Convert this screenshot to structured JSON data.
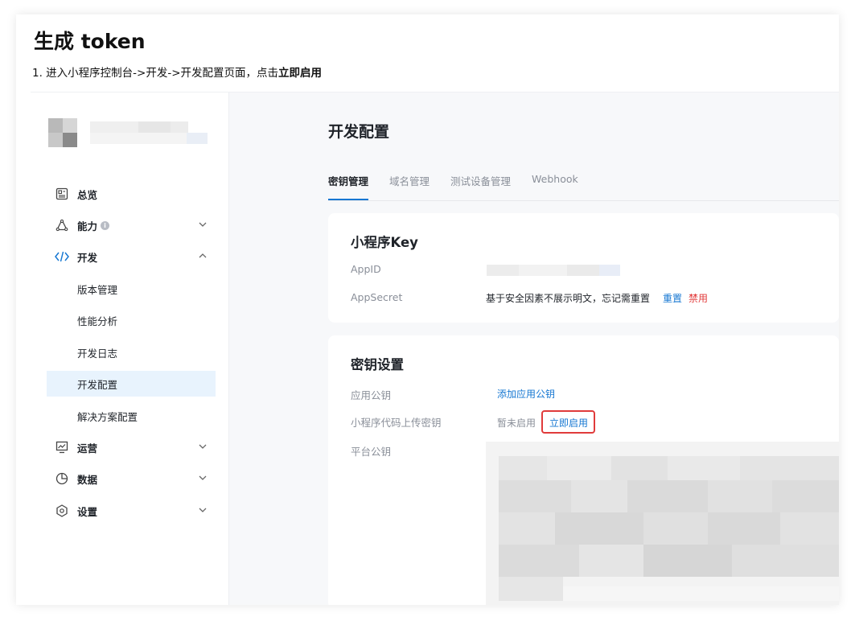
{
  "doc": {
    "title": "生成 token",
    "step_prefix": "1. 进入小程序控制台->开发->开发配置页面，点击",
    "step_bold": "立即启用"
  },
  "sidebar": {
    "items": [
      {
        "label": "总览",
        "icon": "dashboard-icon"
      },
      {
        "label": "能力",
        "icon": "capability-icon",
        "info": "i"
      },
      {
        "label": "开发",
        "icon": "code-icon"
      },
      {
        "label": "运营",
        "icon": "operations-icon"
      },
      {
        "label": "数据",
        "icon": "pie-chart-icon"
      },
      {
        "label": "设置",
        "icon": "settings-icon"
      }
    ],
    "sub_items": [
      {
        "label": "版本管理"
      },
      {
        "label": "性能分析"
      },
      {
        "label": "开发日志"
      },
      {
        "label": "开发配置"
      },
      {
        "label": "解决方案配置"
      }
    ]
  },
  "main": {
    "title": "开发配置",
    "tabs": [
      {
        "label": "密钥管理"
      },
      {
        "label": "域名管理"
      },
      {
        "label": "测试设备管理"
      },
      {
        "label": "Webhook"
      }
    ],
    "key_card": {
      "title": "小程序Key",
      "appid_label": "AppID",
      "appsecret_label": "AppSecret",
      "appsecret_text": "基于安全因素不展示明文，忘记需重置",
      "reset_link": "重置",
      "disable_link": "禁用"
    },
    "secret_card": {
      "title": "密钥设置",
      "app_pubkey_label": "应用公钥",
      "app_pubkey_link": "添加应用公钥",
      "upload_key_label": "小程序代码上传密钥",
      "upload_key_status": "暂未启用",
      "upload_key_enable": "立即启用",
      "platform_pubkey_label": "平台公钥"
    }
  },
  "colors": {
    "accent": "#1677d2",
    "danger": "#e23b3b",
    "highlight": "#e03b3b",
    "active_bg": "#e8f3fd"
  }
}
